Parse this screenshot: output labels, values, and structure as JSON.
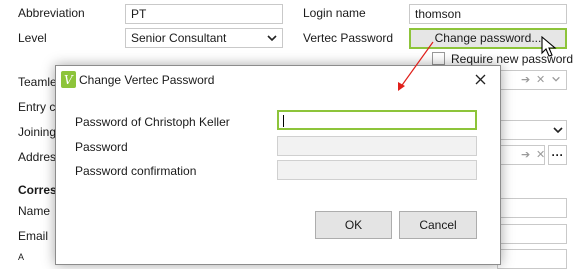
{
  "form": {
    "abbreviation_label": "Abbreviation",
    "abbreviation_value": "PT",
    "level_label": "Level",
    "level_value": "Senior Consultant",
    "login_label": "Login name",
    "login_value": "thomson",
    "vertec_password_label": "Vertec Password",
    "change_password_button": "Change password...",
    "require_new_password_label": "Require new password",
    "teamleader_label_partial": "Teamle",
    "entry_label_partial": "Entry c",
    "joining_label_partial": "Joining",
    "address_label_partial": "Addres",
    "correspondence_heading_partial": "Corresp",
    "name_label": "Name",
    "email_label": "Email"
  },
  "dialog": {
    "title": "Change Vertec Password",
    "password_of_label": "Password of Christoph Keller",
    "password_label": "Password",
    "password_confirmation_label": "Password confirmation",
    "ok_button": "OK",
    "cancel_button": "Cancel"
  },
  "colors": {
    "accent_green": "#8dc43a",
    "annotation_arrow": "#e0201b"
  },
  "icons": {
    "app_icon": "vertec-v-icon",
    "close": "close-icon",
    "dropdown": "chevron-down-icon",
    "arrow": "arrow-right-icon",
    "clear": "clear-x-icon",
    "more": "ellipsis-icon"
  }
}
